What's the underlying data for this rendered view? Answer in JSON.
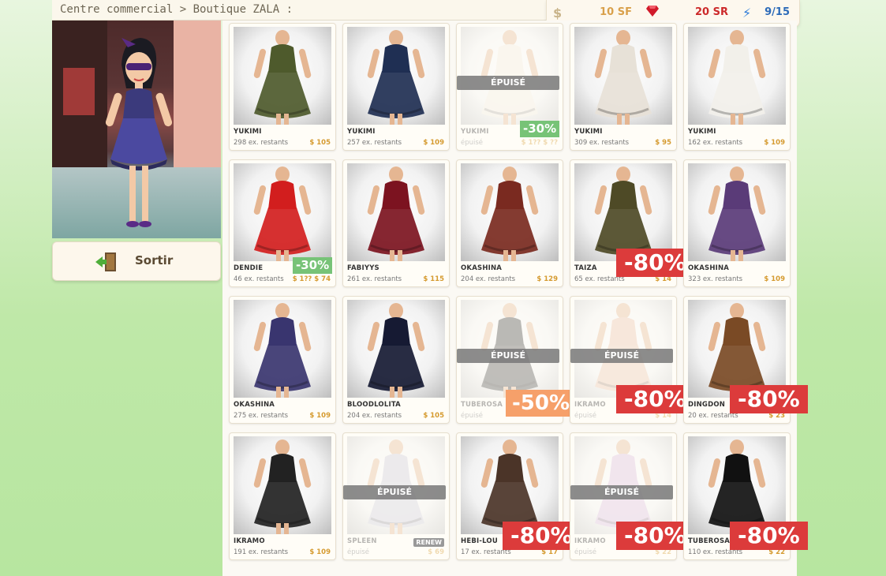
{
  "breadcrumb": "Centre commercial > Boutique ZALA :",
  "currency": {
    "sf": "10 SF",
    "sr": "20 SR",
    "energy": "9/15"
  },
  "sortir_label": "Sortir",
  "epuise_label": "ÉPUISÉ",
  "renew_label": "RENEW",
  "colors": {
    "price": "#d59a2f",
    "discount_red": "#dc3b3b",
    "discount_green": "#77c377"
  },
  "items": [
    {
      "name": "YUKIMI",
      "stock": "298 ex. restants",
      "price": "$ 105",
      "color": "#4e5a2c"
    },
    {
      "name": "YUKIMI",
      "stock": "257 ex. restants",
      "price": "$ 109",
      "color": "#1f2f53"
    },
    {
      "name": "YUKIMI",
      "stock": "épuisé",
      "price": "$ 1?? $ ??",
      "color": "#f1eadf",
      "sold": true,
      "discount": "-30%",
      "discount_style": "green"
    },
    {
      "name": "YUKIMI",
      "stock": "309 ex. restants",
      "price": "$ 95",
      "color": "#e7e1d7"
    },
    {
      "name": "YUKIMI",
      "stock": "162 ex. restants",
      "price": "$ 109",
      "color": "#f2f0ea"
    },
    {
      "name": "DENDIE",
      "stock": "46 ex. restants",
      "price": "$ 1?? $ 74",
      "color": "#d21e1e",
      "discount": "-30%",
      "discount_style": "green"
    },
    {
      "name": "FABIYYS",
      "stock": "261 ex. restants",
      "price": "$ 115",
      "color": "#7c1320"
    },
    {
      "name": "OKASHINA",
      "stock": "204 ex. restants",
      "price": "$ 129",
      "color": "#7a2a20"
    },
    {
      "name": "TAIZA",
      "stock": "65 ex. restants",
      "price": "$ 14",
      "color": "#4e4a26",
      "discount": "-80%",
      "discount_style": "red",
      "renew": true
    },
    {
      "name": "OKASHINA",
      "stock": "323 ex. restants",
      "price": "$ 109",
      "color": "#5a3b78"
    },
    {
      "name": "OKASHINA",
      "stock": "275 ex. restants",
      "price": "$ 109",
      "color": "#39356f"
    },
    {
      "name": "BLOODLOLITA",
      "stock": "204 ex. restants",
      "price": "$ 105",
      "color": "#161a33"
    },
    {
      "name": "TUBEROSA",
      "stock": "épuisé",
      "price": "",
      "color": "#3d3d3d",
      "sold": true,
      "discount": "-50%",
      "discount_style": "orange"
    },
    {
      "name": "IKRAMO",
      "stock": "épuisé",
      "price": "$ 14",
      "color": "#e9c1a8",
      "sold": true,
      "discount": "-80%",
      "discount_style": "red"
    },
    {
      "name": "DINGDON",
      "stock": "20 ex. restants",
      "price": "$ 23",
      "color": "#7a4a25",
      "discount": "-80%",
      "discount_style": "red"
    },
    {
      "name": "IKRAMO",
      "stock": "191 ex. restants",
      "price": "$ 109",
      "color": "#222222"
    },
    {
      "name": "SPLEEN",
      "stock": "épuisé",
      "price": "$ 69",
      "color": "#c9c9d9",
      "sold": true,
      "renew": true
    },
    {
      "name": "HEBI-LOU",
      "stock": "17 ex. restants",
      "price": "$ 17",
      "color": "#4b3428",
      "discount": "-80%",
      "discount_style": "red",
      "renew": true
    },
    {
      "name": "IKRAMO",
      "stock": "épuisé",
      "price": "$ 22",
      "color": "#d8b9dd",
      "sold": true,
      "discount": "-80%",
      "discount_style": "red"
    },
    {
      "name": "TUBEROSA",
      "stock": "110 ex. restants",
      "price": "$ 22",
      "color": "#111111",
      "discount": "-80%",
      "discount_style": "red"
    }
  ]
}
